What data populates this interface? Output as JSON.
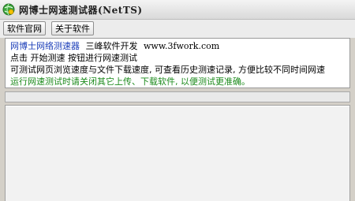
{
  "window": {
    "title": "网博士网速测试器(NetTS)",
    "app_icon": "globe-icon"
  },
  "toolbar": {
    "official_site_label": "软件官网",
    "about_label": "关于软件"
  },
  "info": {
    "app_name": "网博士网络测速器",
    "developer": "三峰软件开发",
    "website": "www.3fwork.com",
    "line2": "点击 开始测速 按钮进行网速测试",
    "line3": "可测试网页浏览速度与文件下载速度, 可查看历史测速记录, 方便比较不同时间网速",
    "line4": "运行网速测试时请关闭其它上传、下载软件, 以便测试更准确。"
  },
  "colors": {
    "app_name": "#1a3db8",
    "tip": "#1b8a1b"
  }
}
